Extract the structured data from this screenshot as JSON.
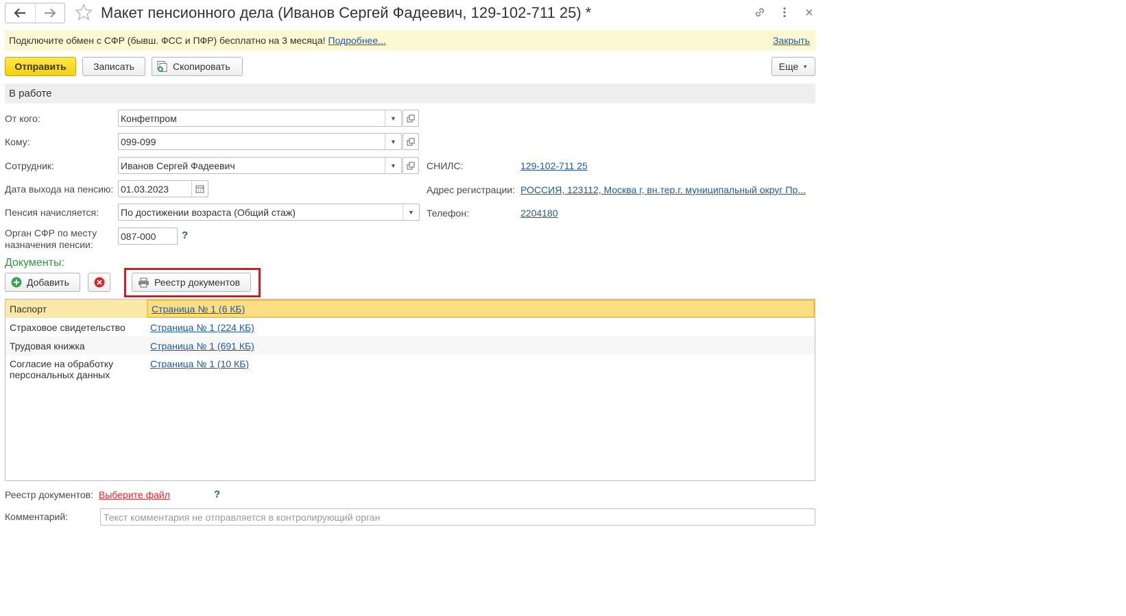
{
  "window": {
    "title": "Макет пенсионного дела (Иванов Сергей Фадеевич, 129-102-711 25) *"
  },
  "info_bar": {
    "text": "Подключите обмен с СФР (бывш. ФСС и ПФР) бесплатно на 3 месяца!",
    "more_link": "Подробнее...",
    "close_link": "Закрыть"
  },
  "toolbar": {
    "send_label": "Отправить",
    "save_label": "Записать",
    "copy_label": "Скопировать",
    "more_label": "Еще"
  },
  "status": "В работе",
  "form": {
    "from_label": "От кого:",
    "from_value": "Конфетпром",
    "to_label": "Кому:",
    "to_value": "099-099",
    "employee_label": "Сотрудник:",
    "employee_value": "Иванов Сергей Фадеевич",
    "retire_date_label": "Дата выхода на пенсию:",
    "retire_date_value": "01.03.2023",
    "pension_label": "Пенсия начисляется:",
    "pension_value": "По достижении возраста (Общий стаж)",
    "sfr_label_line1": "Орган СФР по месту",
    "sfr_label_line2": "назначения пенсии:",
    "sfr_value": "087-000",
    "help": "?",
    "snils_label": "СНИЛС:",
    "snils_value": "129-102-711 25",
    "address_label": "Адрес регистрации:",
    "address_value": "РОССИЯ, 123112, Москва г, вн.тер.г. муниципальный округ Пр...",
    "phone_label": "Телефон:",
    "phone_value": "2204180"
  },
  "documents": {
    "title": "Документы:",
    "add_label": "Добавить",
    "registry_label": "Реестр документов",
    "rows": [
      {
        "name": "Паспорт",
        "file": "Страница № 1 (6 КБ)"
      },
      {
        "name": "Страховое свидетельство",
        "file": "Страница № 1 (224 КБ)"
      },
      {
        "name": "Трудовая книжка",
        "file": "Страница № 1 (691 КБ)"
      },
      {
        "name_line1": "Согласие на обработку",
        "name_line2": "персональных данных",
        "file": "Страница № 1 (10 КБ)"
      }
    ]
  },
  "footer": {
    "registry_label": "Реестр документов:",
    "registry_link": "Выберите файл",
    "help": "?",
    "comment_label": "Комментарий:",
    "comment_placeholder": "Текст комментария не отправляется в контролирующий орган"
  },
  "colors": {
    "primary_button": "#f5cf0b",
    "info_bar": "#fbf8d2",
    "link": "#1d5aa8",
    "section_title": "#2a9a3a",
    "selected_row": "#fbdd84",
    "highlight_frame": "#e0141c",
    "error_link": "#d9262b"
  }
}
